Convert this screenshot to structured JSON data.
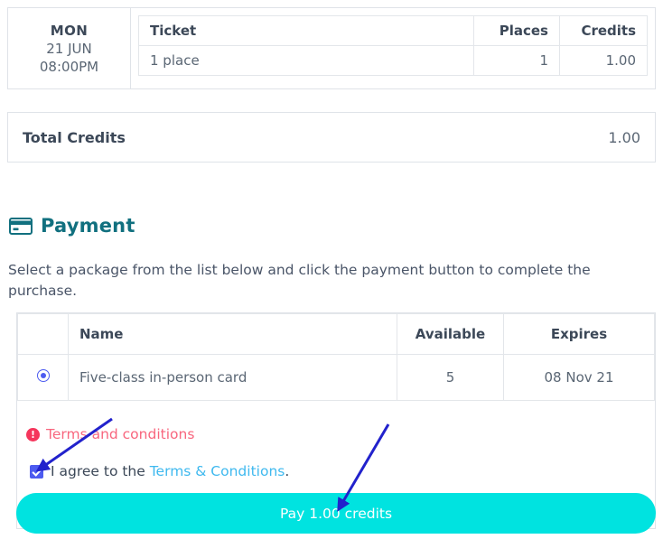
{
  "booking": {
    "date": {
      "day_of_week": "MON",
      "date": "21 JUN",
      "time": "08:00PM"
    },
    "table": {
      "headers": [
        "Ticket",
        "Places",
        "Credits"
      ],
      "rows": [
        {
          "ticket": "1 place",
          "places": "1",
          "credits": "1.00"
        }
      ]
    }
  },
  "total": {
    "label": "Total Credits",
    "value": "1.00"
  },
  "payment": {
    "heading": "Payment",
    "heading_icon": "credit-card-icon",
    "description": "Select a package from the list below and click the payment button to complete the purchase.",
    "packages_table": {
      "headers": [
        "",
        "Name",
        "Available",
        "Expires"
      ],
      "rows": [
        {
          "selected": true,
          "name": "Five-class in-person card",
          "available": "5",
          "expires": "08 Nov 21"
        }
      ]
    },
    "terms_warning": {
      "icon": "exclamation-circle-icon",
      "text": "Terms and conditions",
      "color": "#f8667e"
    },
    "agree": {
      "checked": true,
      "prefix": "I agree to the ",
      "link_text": "Terms & Conditions",
      "suffix": ".",
      "link_color": "#3fb9ef"
    },
    "pay_button": {
      "label": "Pay 1.00 credits",
      "color": "#00e3e0"
    }
  },
  "colors": {
    "accent_teal": "#11707f",
    "radio_blue": "#4d5bf0",
    "annotation_arrow": "#2222cc"
  }
}
